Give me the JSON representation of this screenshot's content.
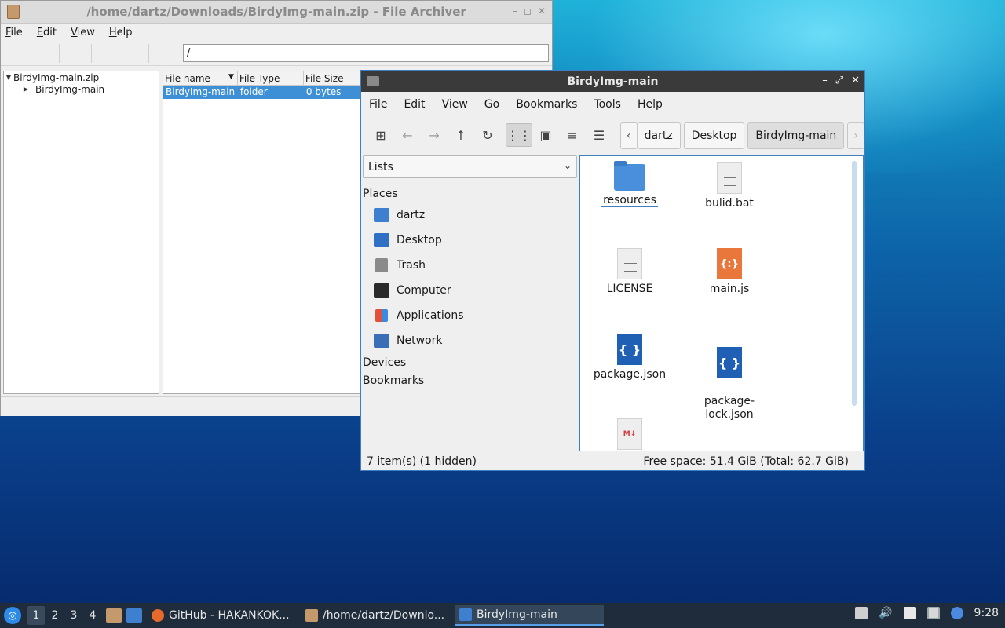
{
  "archiver": {
    "title": "/home/dartz/Downloads/BirdyImg-main.zip - File Archiver",
    "menu": [
      "File",
      "Edit",
      "View",
      "Help"
    ],
    "path": "/",
    "tree": [
      {
        "label": "BirdyImg-main.zip",
        "expanded": true
      },
      {
        "label": "BirdyImg-main",
        "expanded": false
      }
    ],
    "columns": {
      "name": "File name",
      "type": "File Type",
      "size": "File Size"
    },
    "rows": [
      {
        "name": "BirdyImg-main",
        "type": "folder",
        "size": "0 bytes"
      }
    ]
  },
  "fm": {
    "title": "BirdyImg-main",
    "menu": [
      "File",
      "Edit",
      "View",
      "Go",
      "Bookmarks",
      "Tools",
      "Help"
    ],
    "breadcrumbs": [
      "dartz",
      "Desktop",
      "BirdyImg-main"
    ],
    "side_select": "Lists",
    "places_header": "Places",
    "places": [
      {
        "label": "dartz",
        "icon": "home-folder-icon",
        "color": "#3f7fd0"
      },
      {
        "label": "Desktop",
        "icon": "desktop-icon",
        "color": "#2f6fc4"
      },
      {
        "label": "Trash",
        "icon": "trash-icon",
        "color": "#8a8a8a"
      },
      {
        "label": "Computer",
        "icon": "computer-icon",
        "color": "#2a2a2a"
      },
      {
        "label": "Applications",
        "icon": "applications-icon",
        "color": "#e0503a"
      },
      {
        "label": "Network",
        "icon": "network-icon",
        "color": "#3a6fb8"
      }
    ],
    "devices_header": "Devices",
    "bookmarks_header": "Bookmarks",
    "files": [
      {
        "name": "resources",
        "kind": "folder"
      },
      {
        "name": "bulid.bat",
        "kind": "doc"
      },
      {
        "name": "LICENSE",
        "kind": "doc"
      },
      {
        "name": "main.js",
        "kind": "js"
      },
      {
        "name": "package.json",
        "kind": "json"
      },
      {
        "name": "package-\nlock.json",
        "kind": "json"
      },
      {
        "name": "",
        "kind": "md"
      }
    ],
    "status_left": "7 item(s) (1 hidden)",
    "status_right": "Free space: 51.4 GiB (Total: 62.7 GiB)"
  },
  "taskbar": {
    "workspaces": [
      "1",
      "2",
      "3",
      "4"
    ],
    "tasks": [
      {
        "label": "GitHub - HAKANKOK...",
        "icon_color": "#e8692c"
      },
      {
        "label": "/home/dartz/Downlo...",
        "icon_color": "#c49a6c"
      },
      {
        "label": "BirdyImg-main",
        "icon_color": "#3f7fd0"
      }
    ],
    "clock": "9:28"
  }
}
